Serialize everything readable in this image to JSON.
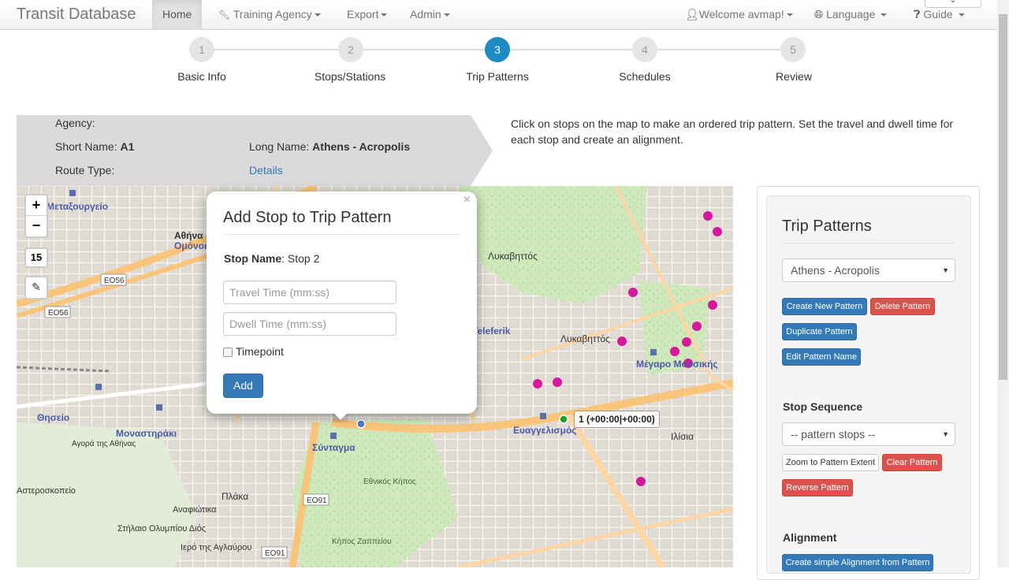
{
  "navbar": {
    "brand": "Transit Database",
    "home": "Home",
    "training_agency": "Training Agency",
    "export": "Export",
    "admin": "Admin",
    "welcome": "Welcome avmap!",
    "language": "Language",
    "guide": "Guide"
  },
  "wizard": {
    "steps": [
      {
        "num": "1",
        "label": "Basic Info"
      },
      {
        "num": "2",
        "label": "Stops/Stations"
      },
      {
        "num": "3",
        "label": "Trip Patterns"
      },
      {
        "num": "4",
        "label": "Schedules"
      },
      {
        "num": "5",
        "label": "Review"
      }
    ],
    "active_step": 3
  },
  "route": {
    "agency_label": "Agency:",
    "short_name_label": "Short Name:",
    "short_name": "A1",
    "long_name_label": "Long Name:",
    "long_name": "Athens - Acropolis",
    "route_type_label": "Route Type:",
    "details_link": "Details"
  },
  "help_text": "Click on stops on the map to make an ordered trip pattern. Set the travel and dwell time for each stop and create an alignment.",
  "map": {
    "zoom_in": "+",
    "zoom_out": "−",
    "zoom_level": "15",
    "stop_tooltip": "1 (+00:00|+00:00)",
    "place_labels": [
      "Μεταξουργείο",
      "Αθήνα",
      "Ομόνοια",
      "Λυκαβηττός",
      "Teleferik",
      "Λυκαβηττός",
      "Μέγαρο Μουσικής",
      "Θησείο",
      "Μοναστηράκι",
      "Σύνταγμα",
      "Ευαγγελισμός",
      "Εθνικός Κήπος",
      "Πλάκα",
      "Αναφιώτικα",
      "Αγορά της Αθήνας",
      "Κήπος Ζαππείου",
      "Ιλίσια",
      "Αστεροσκοπείο",
      "Στήλαιο Ολυμπίου Διός",
      "Ιερό της Αγλαύρου"
    ],
    "road_shields": [
      "ΕΟ56",
      "ΕΟ56",
      "ΕΟ91",
      "ΕΟ91"
    ]
  },
  "popup": {
    "title": "Add Stop to Trip Pattern",
    "close": "×",
    "stop_name_label": "Stop Name",
    "stop_name": "Stop 2",
    "travel_placeholder": "Travel Time (mm:ss)",
    "dwell_placeholder": "Dwell Time (mm:ss)",
    "timepoint_label": "Timepoint",
    "add_button": "Add"
  },
  "panel": {
    "title": "Trip Patterns",
    "pattern_select": "Athens - Acropolis",
    "create_new": "Create New Pattern",
    "delete": "Delete Pattern",
    "duplicate": "Duplicate Pattern",
    "edit_name": "Edit Pattern Name",
    "stop_sequence_title": "Stop Sequence",
    "stops_select": "-- pattern stops --",
    "zoom_extent": "Zoom to Pattern Extent",
    "clear": "Clear Pattern",
    "reverse": "Reverse Pattern",
    "alignment_title": "Alignment",
    "create_alignment": "Create simple Alignment from Pattern"
  },
  "colors": {
    "accent": "#1e8bc3",
    "primary": "#337ab7",
    "danger": "#d9534f"
  }
}
